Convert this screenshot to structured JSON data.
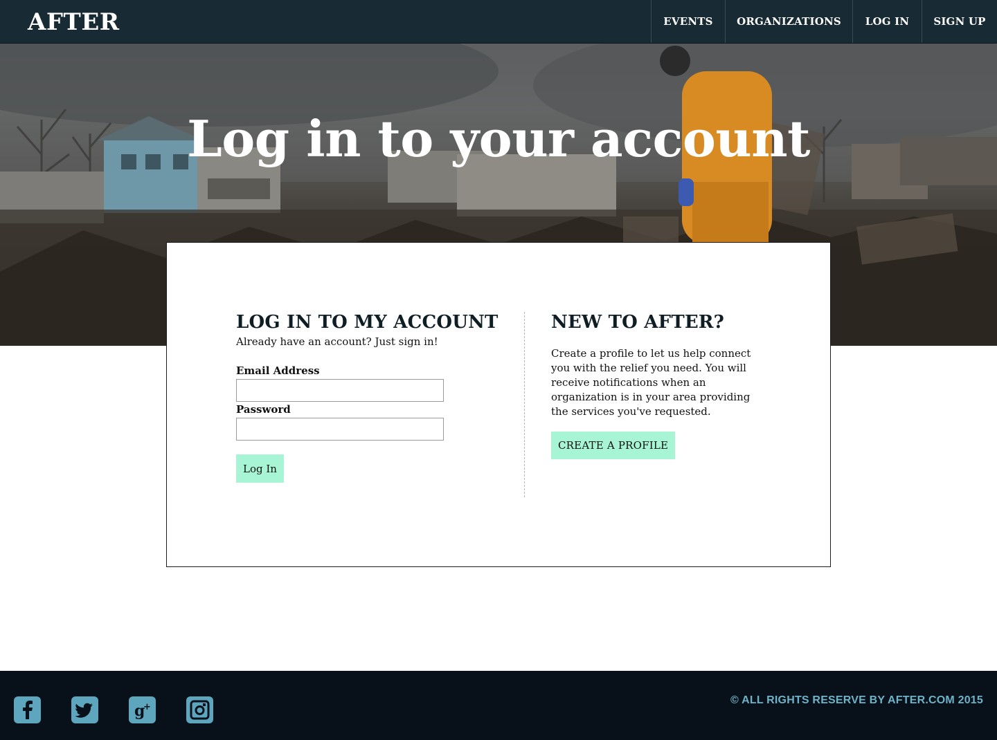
{
  "nav": {
    "brand": "AFTER",
    "items": [
      {
        "label": "EVENTS"
      },
      {
        "label": "ORGANIZATIONS"
      },
      {
        "label": "LOG IN"
      },
      {
        "label": "SIGN UP"
      }
    ]
  },
  "hero": {
    "title": "Log in to your account"
  },
  "login": {
    "heading": "LOG IN TO MY ACCOUNT",
    "subtext": "Already have an account? Just sign in!",
    "email_label": "Email Address",
    "email_value": "",
    "password_label": "Password",
    "password_value": "",
    "submit_label": "Log In"
  },
  "signup": {
    "heading": "NEW TO AFTER?",
    "description": "Create a profile to let us help connect you with the relief you need. You will receive notifications when an organization is in your area providing the services you've requested.",
    "button_label": "CREATE A PROFILE"
  },
  "footer": {
    "social_icons": [
      "facebook-icon",
      "twitter-icon",
      "google-plus-icon",
      "instagram-icon"
    ],
    "copyright": "© ALL RIGHTS RESERVE BY AFTER.COM 2015"
  },
  "colors": {
    "navbar": "#182a33",
    "accent_button": "#a7f5d4",
    "footer": "#08111a",
    "social_icon": "#5da6bd",
    "copyright_text": "#6fb3c8"
  }
}
